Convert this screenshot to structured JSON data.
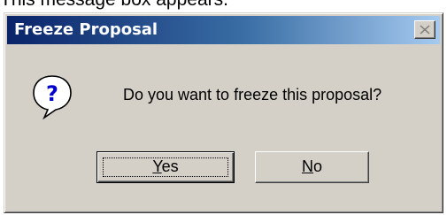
{
  "caption": "This message box appears.",
  "dialog": {
    "title": "Freeze Proposal",
    "message": "Do you want to freeze this proposal?",
    "icon": "question-icon",
    "close_icon": "close-icon",
    "buttons": {
      "yes": {
        "mnemonic": "Y",
        "rest": "es"
      },
      "no": {
        "mnemonic": "N",
        "rest": "o"
      }
    }
  },
  "colors": {
    "dialog_face": "#d4d0c8",
    "titlebar_start": "#0a246a",
    "titlebar_end": "#a6caf0",
    "icon_bubble": "#ffffff",
    "icon_mark": "#0000cc"
  }
}
